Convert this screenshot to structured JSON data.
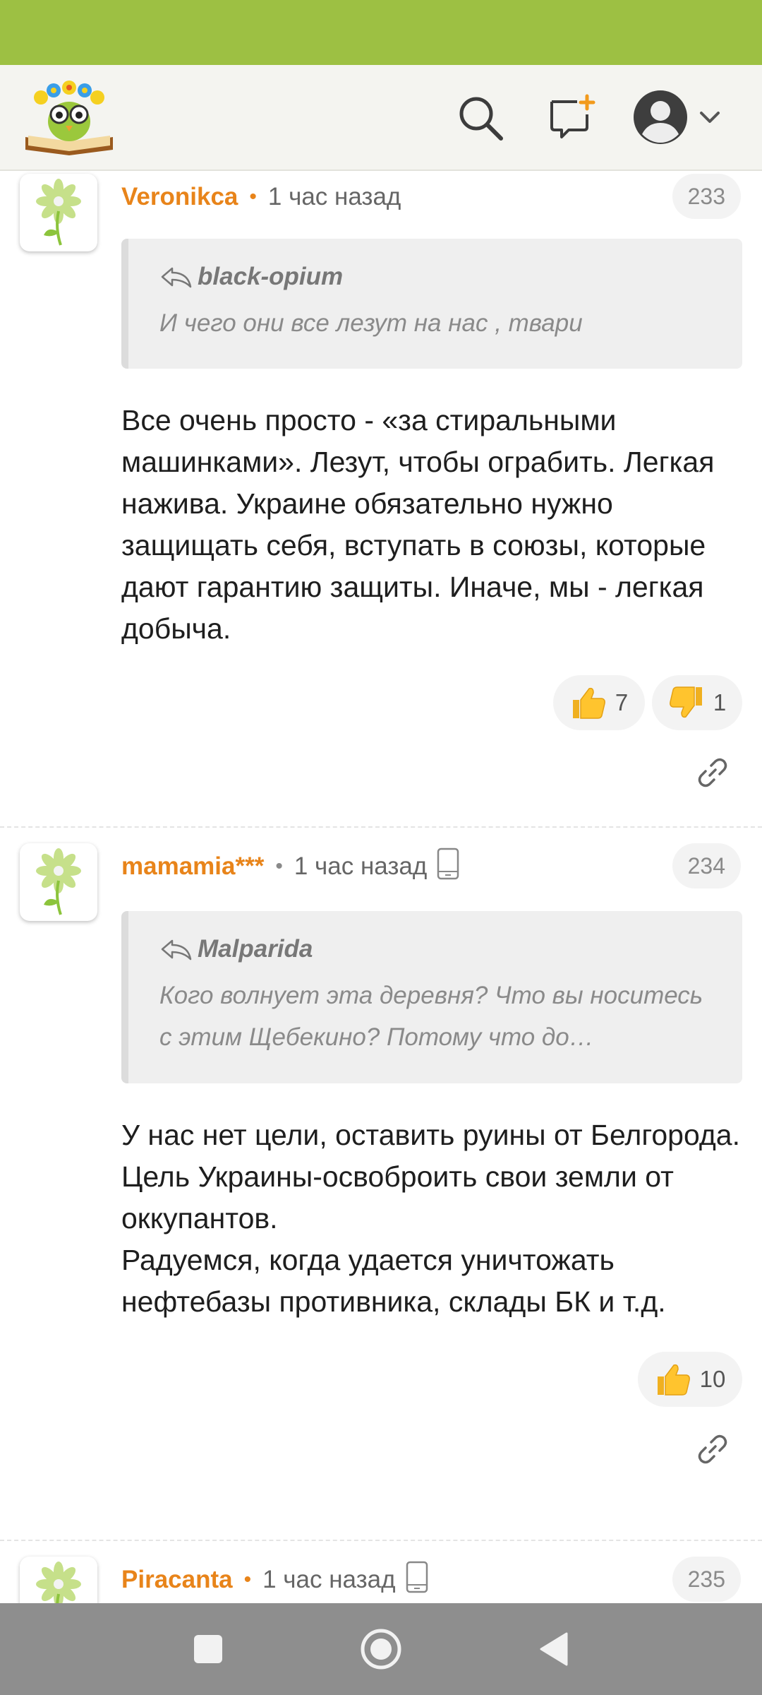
{
  "colors": {
    "status_bar": "#9dc043",
    "username": "#e8841a",
    "nav_bar": "#8e8e8e",
    "header_bg": "#f4f4f0"
  },
  "header": {
    "logo_icon": "owl-book-logo",
    "search_icon": "search-icon",
    "compose_icon": "new-message-icon",
    "profile_icon": "user-avatar-icon"
  },
  "comments": [
    {
      "username": "Veronikca",
      "time": "1 час назад",
      "number": "233",
      "quote_author": "black-opium",
      "quote_text": "И чего они все лезут на нас , твари",
      "text": "Все очень просто - «за стиральными машинками». Лезут, чтобы ограбить. Легкая нажива. Украине обязательно нужно защищать себя, вступать в союзы, которые дают гарантию защиты. Иначе, мы - легкая добыча.",
      "likes": "7",
      "dislikes": "1"
    },
    {
      "username": "mamamia***",
      "time": "1 час назад",
      "number": "234",
      "quote_author": "Malparida",
      "quote_text": "Кого волнует эта деревня? Что вы носитесь с этим Щебекино? Потому что до нормального города не могут дотянуться",
      "text": "У нас нет цели, оставить руины от Белгорода.\nЦель Украины-освоброить свои земли от оккупантов.\nРадуемся, когда удается уничтожать нефтебазы противника, склады БК и т.д.",
      "likes": "10"
    },
    {
      "username": "Piracanta",
      "time": "1 час назад",
      "number": "235"
    }
  ]
}
